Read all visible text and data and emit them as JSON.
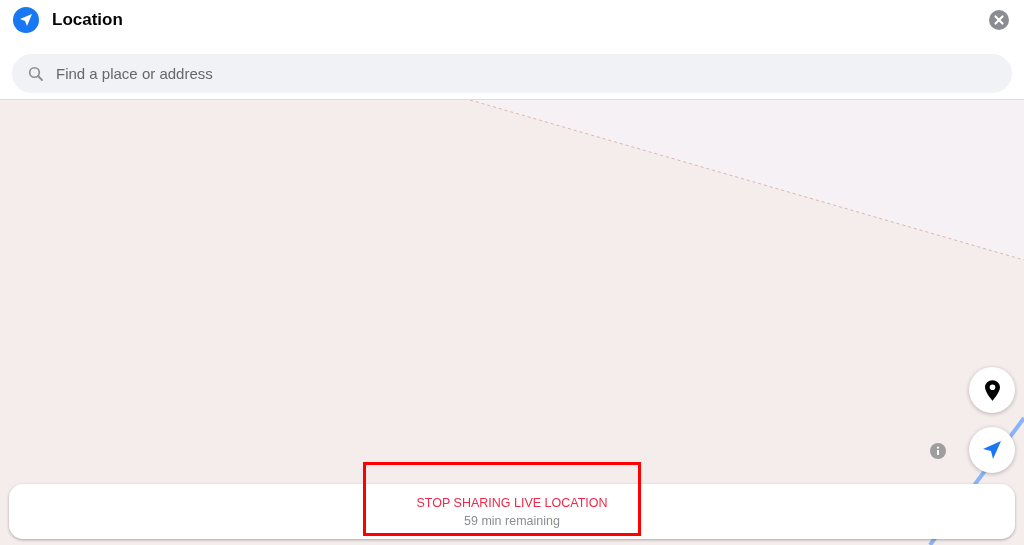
{
  "header": {
    "title": "Location"
  },
  "search": {
    "placeholder": "Find a place or address"
  },
  "live_sharing": {
    "action": "STOP SHARING LIVE LOCATION",
    "remaining": "59 min remaining",
    "highlighted": true
  }
}
